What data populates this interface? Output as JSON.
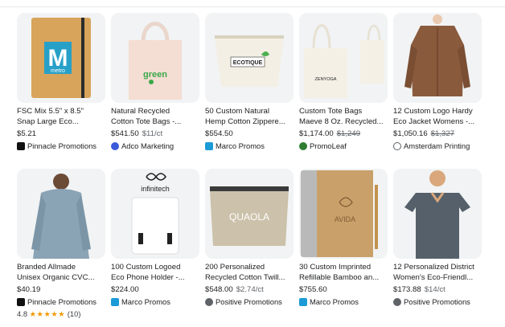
{
  "products": [
    {
      "title1": "FSC Mix 5.5\" x 8.5\"",
      "title2": "Snap Large Eco...",
      "price": "$5.21",
      "sub": "",
      "old": "",
      "seller": "Pinnacle Promotions",
      "seller_icon": "pinnacle-logo-icon",
      "image_text": "metro",
      "brand_letter": "M"
    },
    {
      "title1": "Natural Recycled",
      "title2": "Cotton Tote Bags -...",
      "price": "$541.50",
      "sub": "$11/ct",
      "old": "",
      "seller": "Adco Marketing",
      "seller_icon": "adco-logo-icon",
      "image_text": "green"
    },
    {
      "title1": "50 Custom Natural",
      "title2": "Hemp Cotton Zippere...",
      "price": "$554.50",
      "sub": "",
      "old": "",
      "seller": "Marco Promos",
      "seller_icon": "marco-logo-icon",
      "image_text": "ECOTIQUE"
    },
    {
      "title1": "Custom Tote Bags",
      "title2": "Maeve 8 Oz. Recycled...",
      "price": "$1,174.00",
      "sub": "",
      "old": "$1,249",
      "seller": "PromoLeaf",
      "seller_icon": "promoleaf-logo-icon",
      "image_text": "ZENYOGA"
    },
    {
      "title1": "12 Custom Logo Hardy",
      "title2": "Eco Jacket Womens -...",
      "price": "$1,050.16",
      "sub": "",
      "old": "$1,327",
      "seller": "Amsterdam Printing",
      "seller_icon": "amsterdam-logo-icon",
      "image_text": ""
    },
    {
      "title1": "Branded Allmade",
      "title2": "Unisex Organic CVC...",
      "price": "$40.19",
      "sub": "",
      "old": "",
      "seller": "Pinnacle Promotions",
      "seller_icon": "pinnacle-logo-icon",
      "rating": "4.8",
      "stars": "★★★★★",
      "reviews": "(10)",
      "image_text": ""
    },
    {
      "title1": "100 Custom Logoed",
      "title2": "Eco Phone Holder -...",
      "price": "$224.00",
      "sub": "",
      "old": "",
      "seller": "Marco Promos",
      "seller_icon": "marco-logo-icon",
      "image_text": "infinitech"
    },
    {
      "title1": "200 Personalized",
      "title2": "Recycled Cotton Twill...",
      "price": "$548.00",
      "sub": "$2.74/ct",
      "old": "",
      "seller": "Positive Promotions",
      "seller_icon": "positive-logo-icon",
      "image_text": "QUAOLA"
    },
    {
      "title1": "30 Custom Imprinted",
      "title2": "Refillable Bamboo an...",
      "price": "$755.60",
      "sub": "",
      "old": "",
      "seller": "Marco Promos",
      "seller_icon": "marco-logo-icon",
      "image_text": "AVIDA"
    },
    {
      "title1": "12 Personalized District",
      "title2": "Women's Eco-Friendl...",
      "price": "$173.88",
      "sub": "$14/ct",
      "old": "",
      "seller": "Positive Promotions",
      "seller_icon": "positive-logo-icon",
      "image_text": ""
    }
  ],
  "colors": {
    "card_bg": "#f1f3f4",
    "star": "#f29900",
    "accent_blue": "#1a73e8"
  }
}
